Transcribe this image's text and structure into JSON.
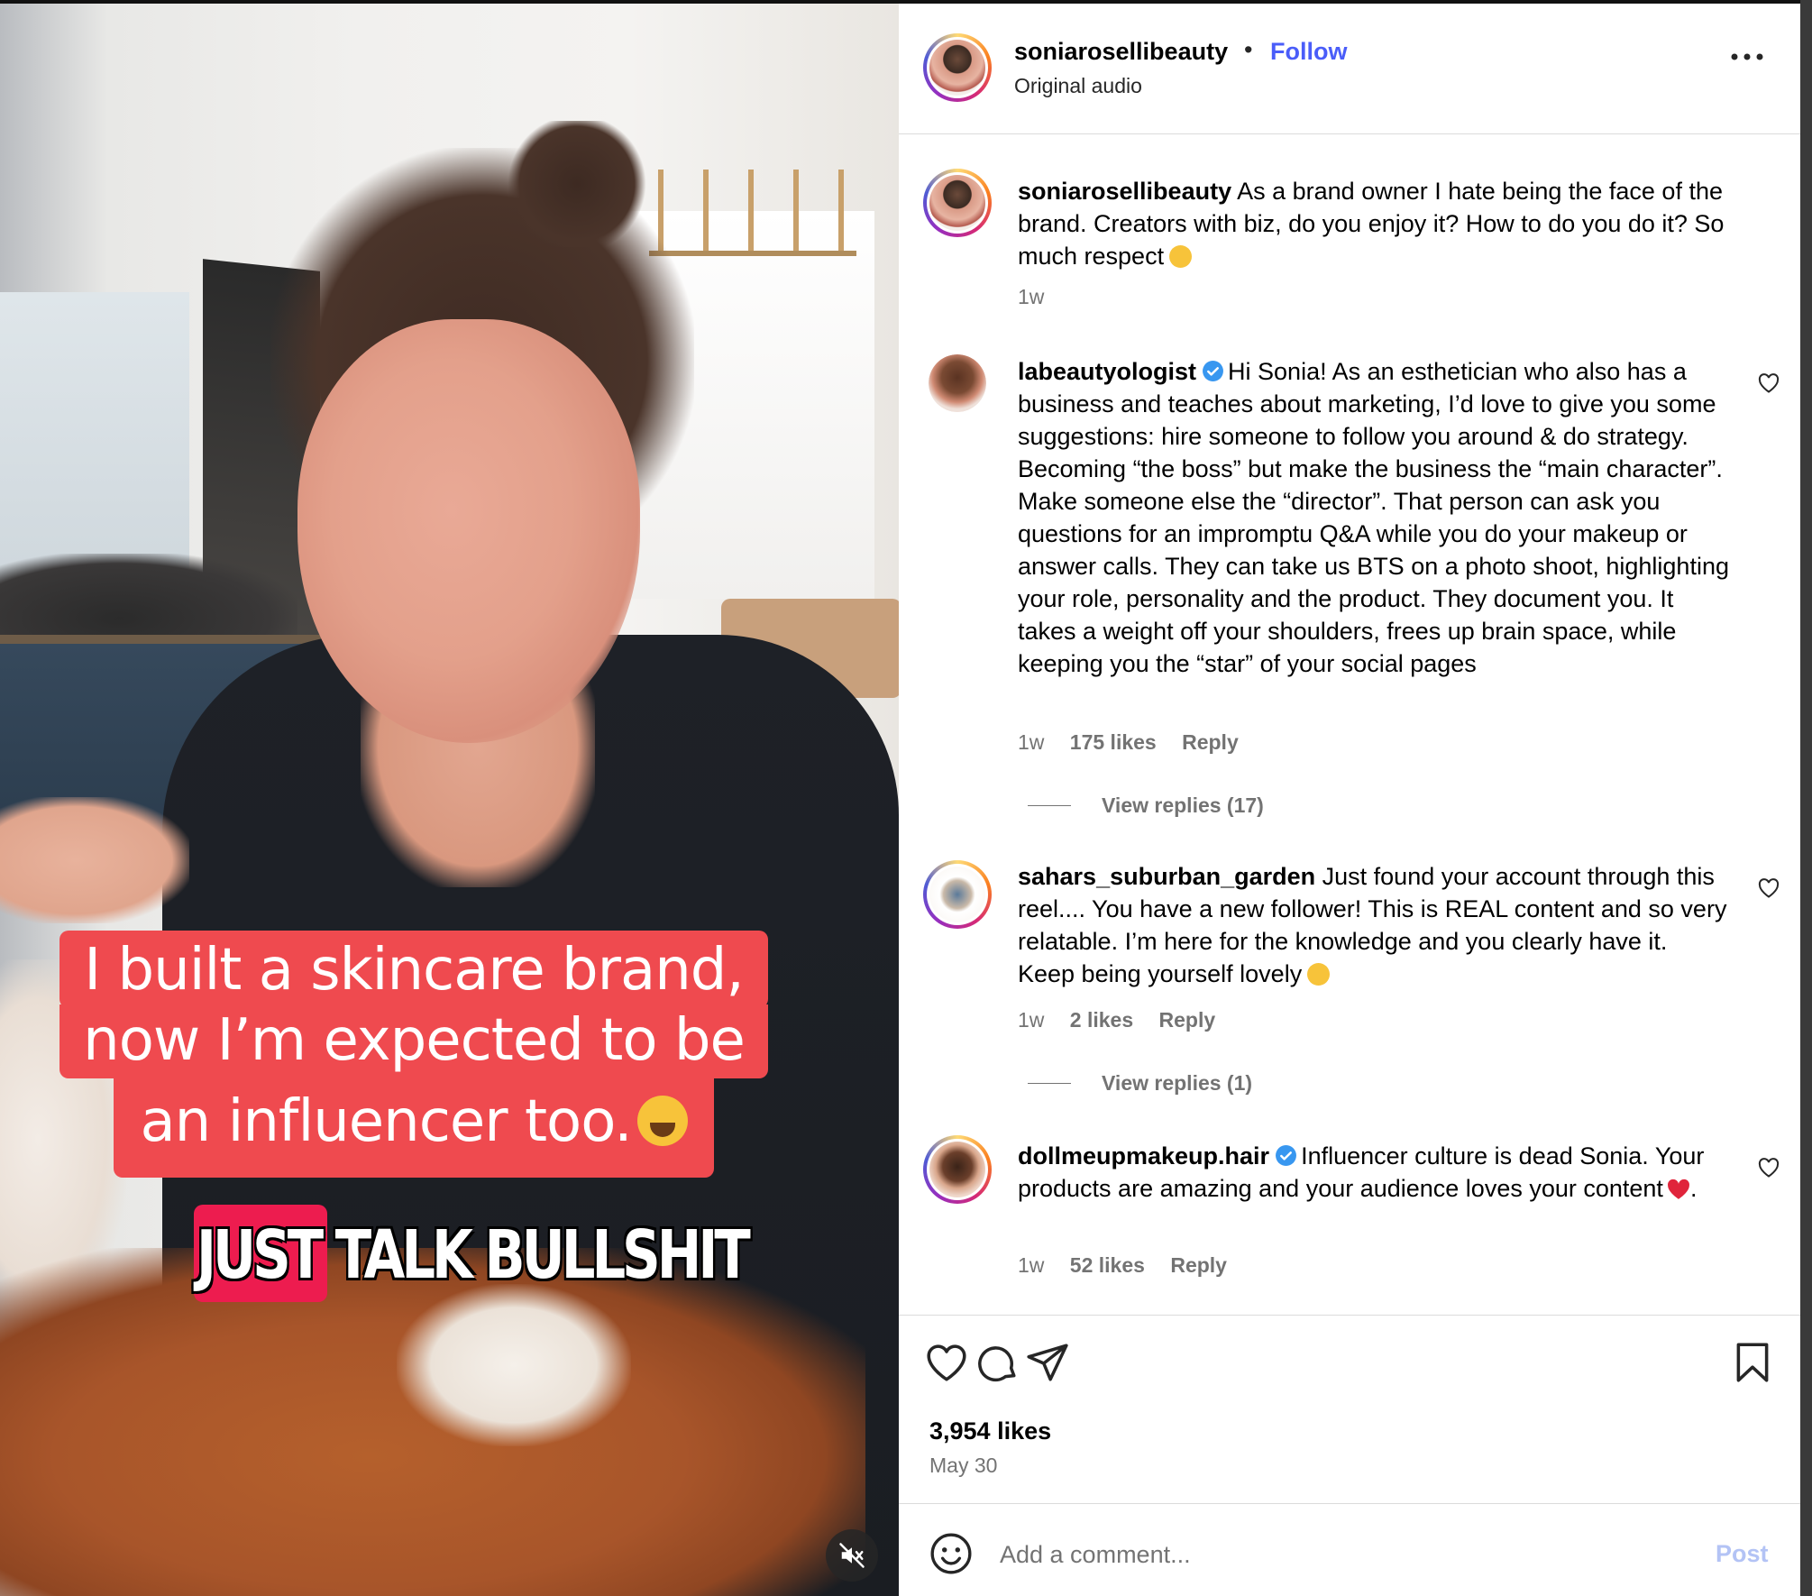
{
  "video": {
    "caption_lines": [
      "I built a skincare brand,",
      "now I’m expected to be",
      "an influencer too."
    ],
    "subtitle": "JUST TALK BULLSHIT",
    "mute_icon": "speaker-muted-icon"
  },
  "header": {
    "username": "soniarosellibeauty",
    "separator": "•",
    "follow_label": "Follow",
    "audio_label": "Original audio",
    "more_icon": "more-horizontal-icon"
  },
  "caption": {
    "username": "soniarosellibeauty",
    "text": "As a brand owner I hate being the face of the brand. Creators with biz, do you enjoy it? How to do you do it? So much respect",
    "time": "1w"
  },
  "comments": [
    {
      "username": "labeautyologist",
      "verified": true,
      "text": "Hi Sonia! As an esthetician who also has a business and teaches about marketing, I’d love to give you some suggestions: hire someone to follow you around & do strategy. Becoming “the boss” but make the business the “main character”. Make someone else the “director”. That person can ask you questions for an impromptu Q&A while you do your makeup or answer calls. They can take us BTS on a photo shoot, highlighting your role, personality and the product. They document you. It takes a weight off your shoulders, frees up brain space, while keeping you the “star” of your social pages",
      "time": "1w",
      "likes": "175 likes",
      "reply": "Reply",
      "view_replies": "View replies (17)"
    },
    {
      "username": "sahars_suburban_garden",
      "verified": false,
      "text": "Just found your account through this reel.... You have a new follower! This is REAL content and so very relatable. I’m here for the knowledge and you clearly have it. Keep being yourself lovely",
      "time": "1w",
      "likes": "2 likes",
      "reply": "Reply",
      "view_replies": "View replies (1)"
    },
    {
      "username": "dollmeupmakeup.hair",
      "verified": true,
      "text": "Influencer culture is dead Sonia. Your products are amazing and your audience loves your content",
      "text_end": ".",
      "time": "1w",
      "likes": "52 likes",
      "reply": "Reply"
    }
  ],
  "actions": {
    "likes": "3,954 likes",
    "date": "May 30",
    "icons": [
      "heart-icon",
      "comment-icon",
      "share-icon",
      "bookmark-icon"
    ]
  },
  "composer": {
    "placeholder": "Add a comment...",
    "post_label": "Post"
  },
  "colors": {
    "follow": "#4a5df9",
    "caption_bg": "#ef4a4f",
    "subtitle_highlight": "#ed1c4f",
    "post_disabled": "#b3c3f5"
  }
}
